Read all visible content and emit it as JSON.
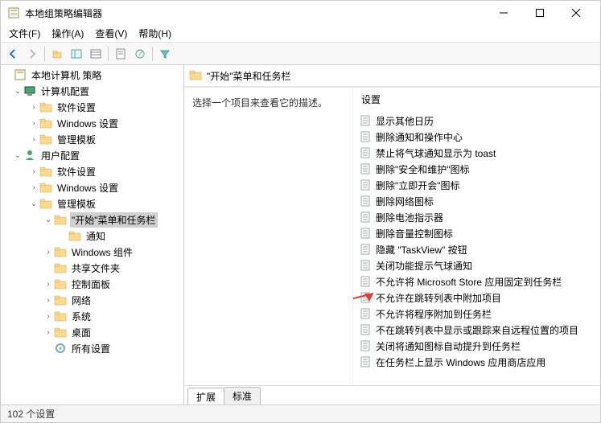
{
  "window": {
    "title": "本地组策略编辑器"
  },
  "menu": {
    "file": "文件(F)",
    "action": "操作(A)",
    "view": "查看(V)",
    "help": "帮助(H)"
  },
  "tree": {
    "root": "本地计算机 策略",
    "computer": "计算机配置",
    "c_software": "软件设置",
    "c_windows": "Windows 设置",
    "c_admin": "管理模板",
    "user": "用户配置",
    "u_software": "软件设置",
    "u_windows": "Windows 设置",
    "u_admin": "管理模板",
    "start_task": "\"开始\"菜单和任务栏",
    "notify": "通知",
    "win_comp": "Windows 组件",
    "shared": "共享文件夹",
    "control": "控制面板",
    "network": "网络",
    "system": "系统",
    "desktop": "桌面",
    "all": "所有设置"
  },
  "content": {
    "location": "\"开始\"菜单和任务栏",
    "desc_prompt": "选择一个项目来查看它的描述。",
    "col_head": "设置",
    "policies": [
      "显示其他日历",
      "删除通知和操作中心",
      "禁止将气球通知显示为 toast",
      "删除\"安全和维护\"图标",
      "删除\"立即开会\"图标",
      "删除网络图标",
      "删除电池指示器",
      "删除音量控制图标",
      "隐藏 \"TaskView\" 按钮",
      "关闭功能提示气球通知",
      "不允许将 Microsoft Store 应用固定到任务栏",
      "不允许在跳转列表中附加项目",
      "不允许将程序附加到任务栏",
      "不在跳转列表中显示或跟踪来自远程位置的项目",
      "关闭将通知图标自动提升到任务栏",
      "在任务栏上显示 Windows 应用商店应用"
    ]
  },
  "tabs": {
    "extended": "扩展",
    "standard": "标准"
  },
  "status": {
    "text": "102 个设置"
  }
}
